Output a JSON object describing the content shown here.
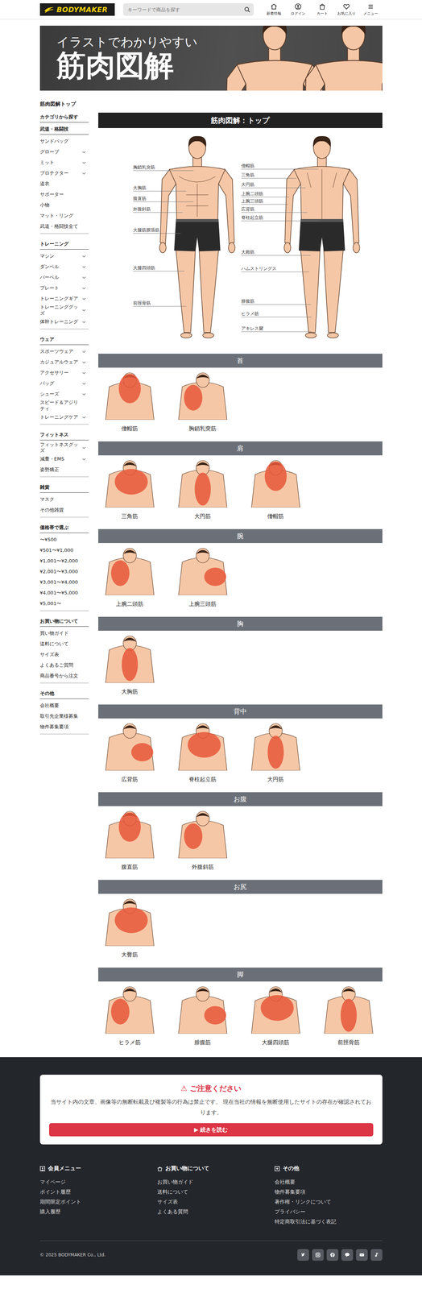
{
  "header": {
    "logo": "BODYMAKER",
    "search": {
      "placeholder": "キーワードで商品を探す"
    },
    "nav": [
      "新着情報",
      "ログイン",
      "カート",
      "お気に入り",
      "メニュー"
    ]
  },
  "banner": {
    "subtitle": "イラストでわかりやすい",
    "title": "筋肉図解"
  },
  "breadcrumb": "筋肉図解トップ",
  "sidebar": {
    "blocks": [
      {
        "title": "カテゴリから探す",
        "items": []
      },
      {
        "title": "武道・格闘技",
        "items": [
          {
            "label": "サンドバッグ",
            "expandable": false
          },
          {
            "label": "グローブ",
            "expandable": true
          },
          {
            "label": "ミット",
            "expandable": true
          },
          {
            "label": "プロテクター",
            "expandable": true
          },
          {
            "label": "道衣",
            "expandable": false
          },
          {
            "label": "サポーター",
            "expandable": false
          },
          {
            "label": "小物",
            "expandable": false
          },
          {
            "label": "マット・リング",
            "expandable": false
          },
          {
            "label": "武道・格闘技全て",
            "expandable": false
          }
        ]
      },
      {
        "title": "トレーニング",
        "items": [
          {
            "label": "マシン",
            "expandable": true
          },
          {
            "label": "ダンベル",
            "expandable": true
          },
          {
            "label": "バーベル",
            "expandable": true
          },
          {
            "label": "プレート",
            "expandable": true
          },
          {
            "label": "トレーニングギア",
            "expandable": true
          },
          {
            "label": "トレーニンググッズ",
            "expandable": true
          },
          {
            "label": "体幹トレーニング",
            "expandable": true
          }
        ]
      },
      {
        "title": "ウェア",
        "items": [
          {
            "label": "スポーツウェア",
            "expandable": true
          },
          {
            "label": "カジュアルウェア",
            "expandable": true
          },
          {
            "label": "アクセサリー",
            "expandable": true
          },
          {
            "label": "バッグ",
            "expandable": true
          },
          {
            "label": "シューズ",
            "expandable": true
          },
          {
            "label": "スピード＆アジリティ",
            "expandable": false
          },
          {
            "label": "トレーニングケア",
            "expandable": true
          }
        ]
      },
      {
        "title": "フィットネス",
        "items": [
          {
            "label": "フィットネスグッズ",
            "expandable": true
          },
          {
            "label": "減量・EMS",
            "expandable": true
          },
          {
            "label": "姿勢矯正",
            "expandable": false
          }
        ]
      },
      {
        "title": "雑貨",
        "items": [
          {
            "label": "マスク",
            "expandable": false
          },
          {
            "label": "その他雑貨",
            "expandable": false
          }
        ]
      },
      {
        "title": "価格帯で選ぶ",
        "items": [
          {
            "label": "〜¥500",
            "expandable": false
          },
          {
            "label": "¥501〜¥1,000",
            "expandable": false
          },
          {
            "label": "¥1,001〜¥2,000",
            "expandable": false
          },
          {
            "label": "¥2,001〜¥3,000",
            "expandable": false
          },
          {
            "label": "¥3,001〜¥4,000",
            "expandable": false
          },
          {
            "label": "¥4,001〜¥5,000",
            "expandable": false
          },
          {
            "label": "¥5,001〜",
            "expandable": false
          }
        ]
      },
      {
        "title": "お買い物について",
        "items": [
          {
            "label": "買い物ガイド",
            "expandable": false
          },
          {
            "label": "送料について",
            "expandable": false
          },
          {
            "label": "サイズ表",
            "expandable": false
          },
          {
            "label": "よくあるご質問",
            "expandable": false
          },
          {
            "label": "商品番号から注文",
            "expandable": false
          }
        ]
      },
      {
        "title": "その他",
        "items": [
          {
            "label": "会社概要",
            "expandable": false
          },
          {
            "label": "取引先企業様募集",
            "expandable": false
          },
          {
            "label": "物件募集要項",
            "expandable": false
          }
        ]
      }
    ]
  },
  "main_title": "筋肉図解：トップ",
  "diagram": {
    "front_labels": [
      "胸鎖乳突筋",
      "大胸筋",
      "腹直筋",
      "外腹斜筋",
      "大腿筋膜張筋",
      "大腿四頭筋",
      "前脛骨筋"
    ],
    "back_labels": [
      "僧帽筋",
      "三角筋",
      "大円筋",
      "上腕二頭筋",
      "上腕三頭筋",
      "広背筋",
      "脊柱起立筋",
      "大殿筋",
      "ハムストリングス",
      "腓腹筋",
      "ヒラメ筋",
      "アキレス腱"
    ]
  },
  "sections": [
    {
      "title": "首",
      "items": [
        "僧帽筋",
        "胸鎖乳突筋"
      ]
    },
    {
      "title": "肩",
      "items": [
        "三角筋",
        "大円筋",
        "僧帽筋"
      ]
    },
    {
      "title": "腕",
      "items": [
        "上腕二頭筋",
        "上腕三頭筋"
      ]
    },
    {
      "title": "胸",
      "items": [
        "大胸筋"
      ]
    },
    {
      "title": "背中",
      "items": [
        "広背筋",
        "脊柱起立筋",
        "大円筋"
      ]
    },
    {
      "title": "お腹",
      "items": [
        "腹直筋",
        "外腹斜筋"
      ]
    },
    {
      "title": "お尻",
      "items": [
        "大臀筋"
      ]
    },
    {
      "title": "脚",
      "items": [
        "ヒラメ筋",
        "腓腹筋",
        "大腿四頭筋",
        "前脛骨筋"
      ]
    }
  ],
  "notice": {
    "icon": "⚠",
    "title": "ご注意ください",
    "text": "当サイト内の文章、画像等の無断転載及び複製等の行為は禁止です。 現在当社の情報を無断使用したサイトの存在が確認されております。",
    "button": "▶ 続きを読む"
  },
  "footer": {
    "columns": [
      {
        "title": "会員メニュー",
        "links": [
          "マイページ",
          "ポイント履歴",
          "期間限定ポイント",
          "購入履歴"
        ]
      },
      {
        "title": "お買い物について",
        "links": [
          "お買い物ガイド",
          "送料について",
          "サイズ表",
          "よくある質問"
        ]
      },
      {
        "title": "その他",
        "links": [
          "会社概要",
          "物件募集要項",
          "著作権・リンクについて",
          "プライバシー",
          "特定商取引法に基づく表記"
        ]
      }
    ],
    "copyright": "© 2025 BODYMAKER Co., Ltd."
  }
}
